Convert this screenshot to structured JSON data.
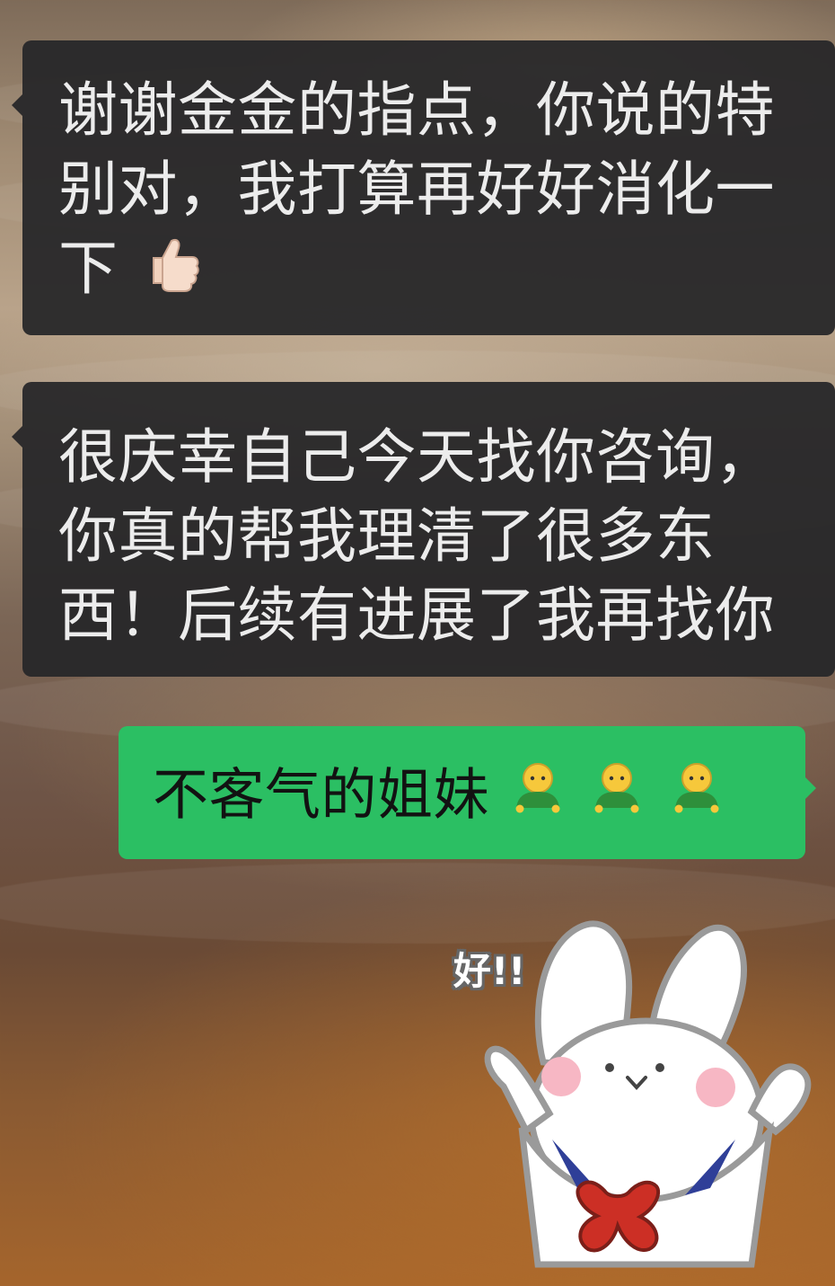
{
  "messages": [
    {
      "id": "m1",
      "direction": "incoming",
      "lines": [
        "谢谢金金的指点，你说的特",
        "别对，我打算再好好消化一",
        "下"
      ],
      "emoji_name": "thumbs-up-light-skin-icon"
    },
    {
      "id": "m2",
      "direction": "incoming",
      "lines": [
        "很庆幸自己今天找你咨询，",
        "你真的帮我理清了很多东",
        "西！后续有进展了我再找你"
      ]
    },
    {
      "id": "m3",
      "direction": "outgoing",
      "text": "不客气的姐妹",
      "emoji_names": [
        "person-green-icon",
        "person-green-icon",
        "person-green-icon"
      ]
    }
  ],
  "sticker": {
    "name": "bunny-sticker",
    "text": "好!!"
  },
  "colors": {
    "incoming_bubble": "#262628",
    "outgoing_bubble": "#2bbf63",
    "incoming_text": "#ececec",
    "outgoing_text": "#121212"
  }
}
